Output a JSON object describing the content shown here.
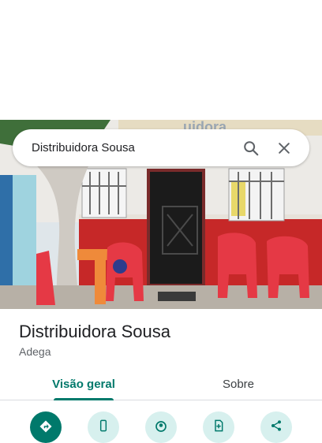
{
  "search": {
    "query": "Distribuidora Sousa"
  },
  "icons": {
    "search": "search-icon",
    "close": "close-icon",
    "directions": "directions-icon",
    "call": "phone-icon",
    "nearby": "nearby-icon",
    "save": "save-icon",
    "share": "share-icon"
  },
  "photo": {
    "sign_text": "uidora"
  },
  "place": {
    "name": "Distribuidora Sousa",
    "category": "Adega"
  },
  "tabs": [
    {
      "label": "Visão geral",
      "active": true
    },
    {
      "label": "Sobre",
      "active": false
    }
  ],
  "colors": {
    "accent": "#00796b",
    "accent_light": "#d7f0ee",
    "wall_red": "#c62828",
    "chair_red": "#e53945"
  }
}
